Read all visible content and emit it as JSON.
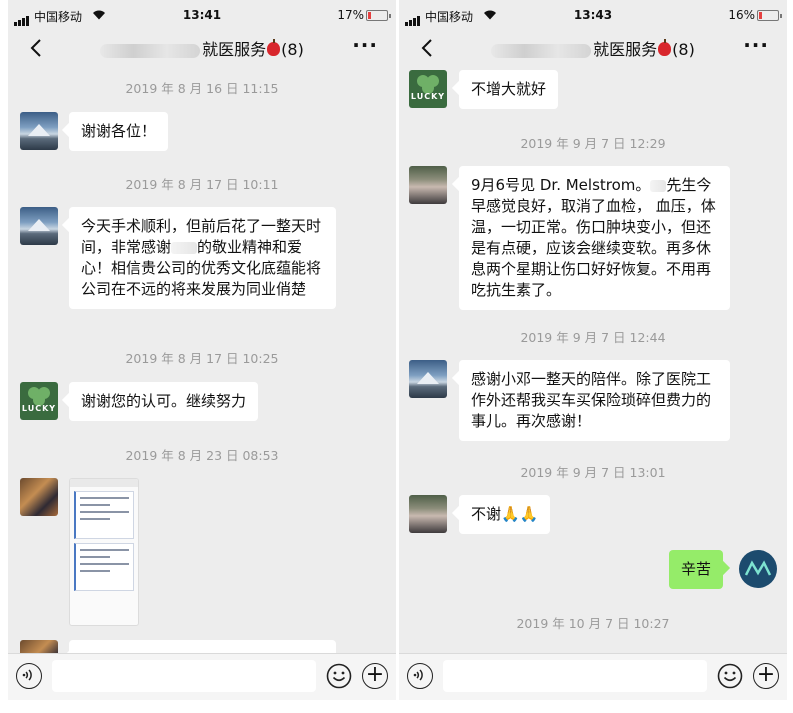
{
  "left": {
    "status": {
      "carrier": "中国移动",
      "time": "13:41",
      "battery": "17%"
    },
    "nav": {
      "title_suffix": "就医服务",
      "count": "(8)"
    },
    "chat": {
      "ts1": "2019 年 8 月 16 日 11:15",
      "msg1": "谢谢各位！",
      "ts2": "2019 年 8 月 17 日 10:11",
      "msg2_a": "今天手术顺利，但前后花了一整天时间，非常感谢",
      "msg2_b": "的敬业精神和爱心！相信贵公司的优秀文化底蕴能将公司在不远的将来发展为同业俏楚",
      "ts3": "2019 年 8 月 17 日 10:25",
      "msg3": "谢谢您的认可。继续努力",
      "ts4": "2019 年 8 月 23 日 08:53"
    }
  },
  "right": {
    "status": {
      "carrier": "中国移动",
      "time": "13:43",
      "battery": "16%"
    },
    "nav": {
      "title_suffix": "就医服务",
      "count": "(8)"
    },
    "chat": {
      "msg0": "不增大就好",
      "ts1": "2019 年 9 月 7 日 12:29",
      "msg1_a": "9月6号见 Dr. Melstrom。",
      "msg1_b": "先生今早感觉良好，取消了血检， 血压，体温，一切正常。伤口肿块变小，但还是有点硬，应该会继续变软。再多休息两个星期让伤口好好恢复。不用再吃抗生素了。",
      "ts2": "2019 年 9 月 7 日 12:44",
      "msg2": "感谢小邓一整天的陪伴。除了医院工作外还帮我买车买保险琐碎但费力的事儿。再次感谢！",
      "ts3": "2019 年 9 月 7 日 13:01",
      "msg3": "不谢🙏🙏",
      "msg4": "辛苦",
      "ts4": "2019 年 10 月 7 日 10:27"
    }
  },
  "avatars": {
    "lucky_text": "LUCKY"
  },
  "colors": {
    "chat_bg": "#ededed",
    "bubble_white": "#ffffff",
    "bubble_green": "#95ec69",
    "timestamp": "#9a9a9a"
  }
}
